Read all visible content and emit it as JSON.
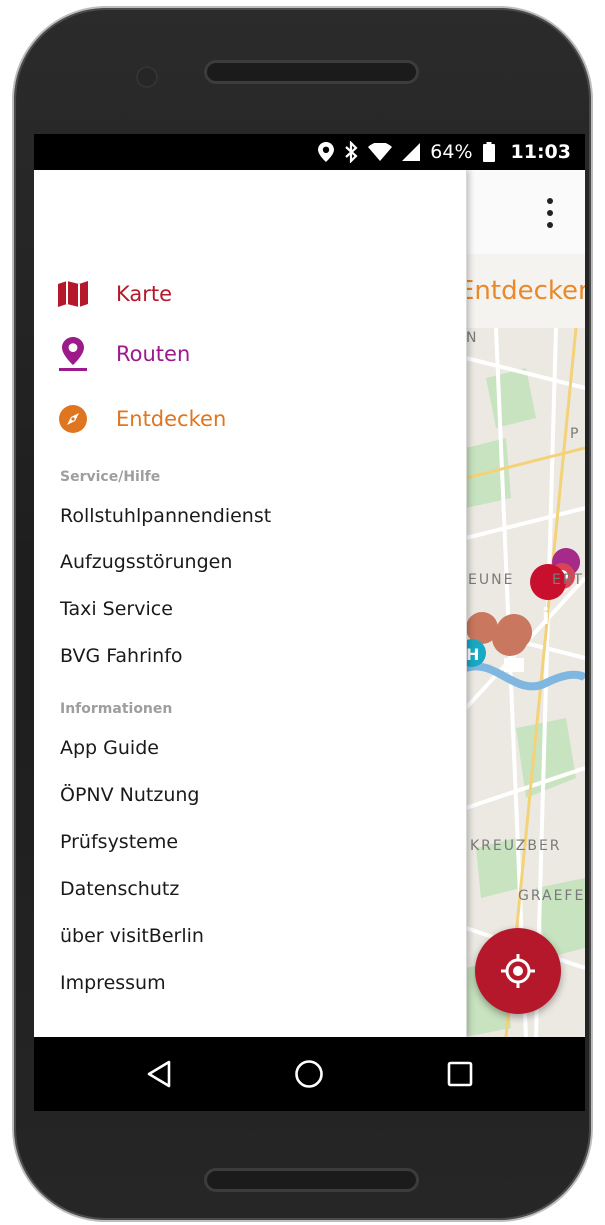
{
  "status_bar": {
    "battery": "64%",
    "time": "11:03",
    "icons": [
      "location-pin-icon",
      "bluetooth-icon",
      "wifi-icon",
      "signal-icon",
      "battery-icon"
    ]
  },
  "appbar": {
    "overflow_icon": "more-vert-icon",
    "subtitle": "Entdecken"
  },
  "map": {
    "labels": [
      "N",
      "P",
      "EUNE",
      "ERT",
      "KREUZBER",
      "GRAEFE"
    ],
    "fab_icon": "my-location-icon"
  },
  "drawer": {
    "nav": [
      {
        "label": "Karte",
        "icon": "map-icon",
        "color": "#b5182b"
      },
      {
        "label": "Routen",
        "icon": "route-pin-icon",
        "color": "#9c1a8a"
      },
      {
        "label": "Entdecken",
        "icon": "compass-icon",
        "color": "#e07520"
      }
    ],
    "sections": [
      {
        "title": "Service/Hilfe",
        "items": [
          "Rollstuhlpannendienst",
          "Aufzugsstörungen",
          "Taxi Service",
          "BVG Fahrinfo"
        ]
      },
      {
        "title": "Informationen",
        "items": [
          "App Guide",
          "ÖPNV Nutzung",
          "Prüfsysteme",
          "Datenschutz",
          "über visitBerlin",
          "Impressum"
        ]
      }
    ]
  },
  "navbar": {
    "icons": [
      "back-icon",
      "home-icon",
      "recents-icon"
    ]
  }
}
